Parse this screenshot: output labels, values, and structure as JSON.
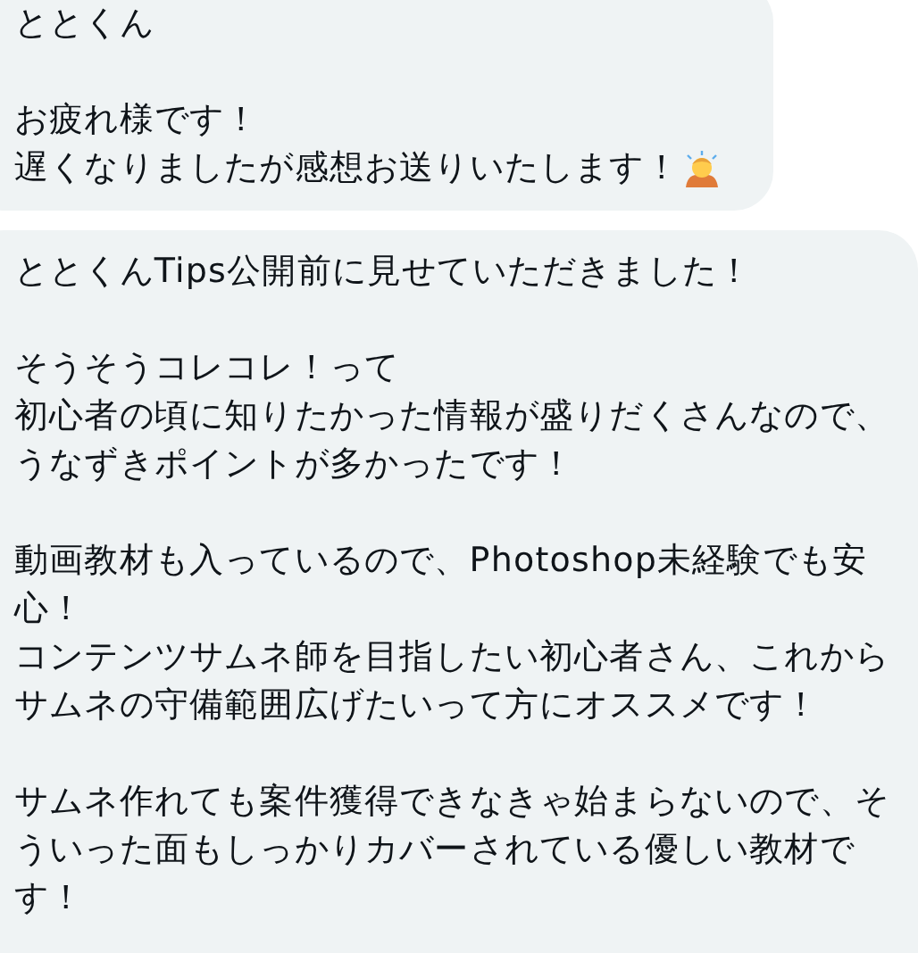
{
  "messages": [
    {
      "paragraphs": [
        [
          "ととくん"
        ],
        [
          "お疲れ様です！",
          "遅くなりましたが感想お送りいたします！"
        ]
      ],
      "trailing_emoji": true
    },
    {
      "paragraphs": [
        [
          "ととくんTips公開前に見せていただきました！"
        ],
        [
          "そうそうコレコレ！って",
          "初心者の頃に知りたかった情報が盛りだくさんなので、",
          "うなずきポイントが多かったです！"
        ],
        [
          "動画教材も入っているので、Photoshop未経験でも安",
          "心！",
          "コンテンツサムネ師を目指したい初心者さん、これから",
          "サムネの守備範囲広げたいって方にオススメです！"
        ],
        [
          "サムネ作れても案件獲得できなきゃ始まらないので、そ",
          "ういった面もしっかりカバーされている優しい教材で",
          "す！"
        ]
      ]
    }
  ]
}
